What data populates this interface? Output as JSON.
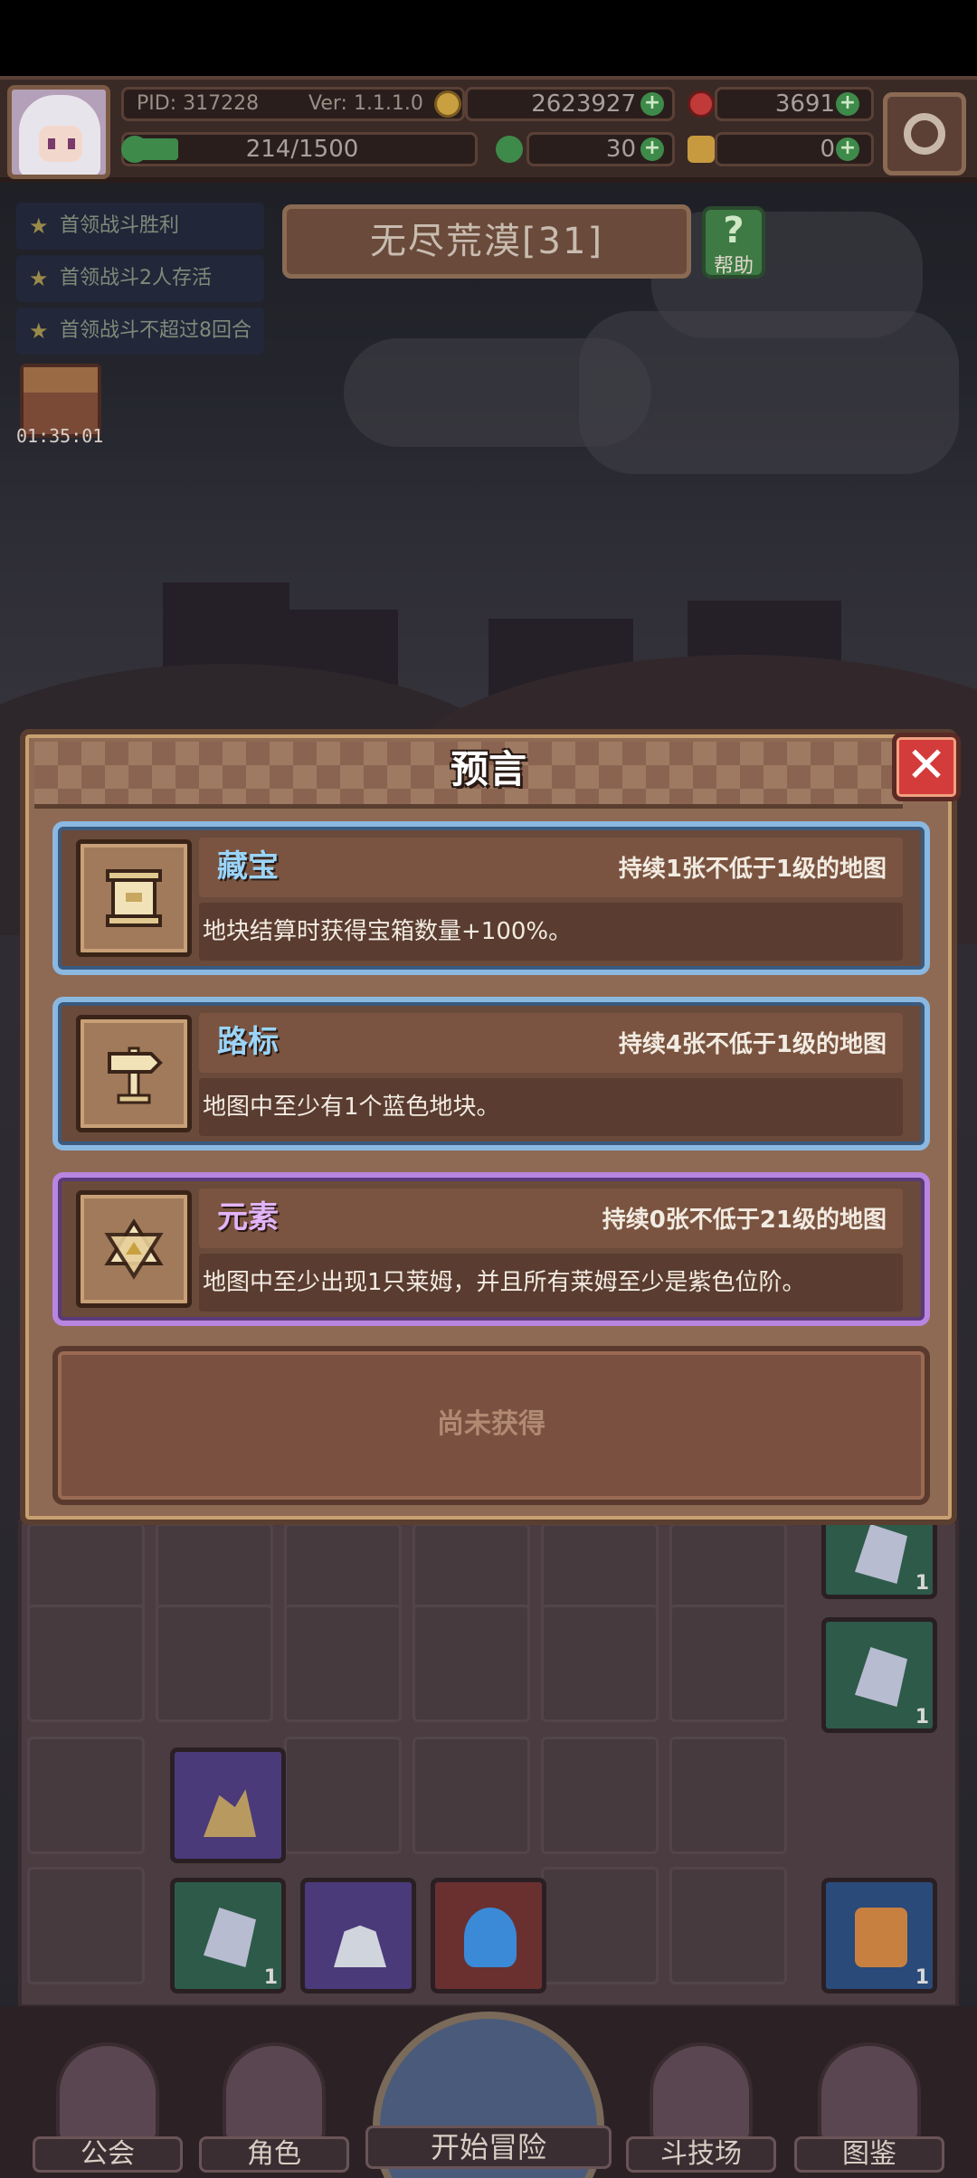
{
  "hud": {
    "pid_label": "PID: 317228",
    "version_label": "Ver: 1.1.1.0",
    "gold": "2623927",
    "gems": "3691",
    "xp": "214/1500",
    "clover": "30",
    "thumb": "0"
  },
  "quests": [
    {
      "label": "首领战斗胜利"
    },
    {
      "label": "首领战斗2人存活"
    },
    {
      "label": "首领战斗不超过8回合"
    }
  ],
  "chest_timer": "01:35:01",
  "map": {
    "title": "无尽荒漠[31]",
    "help_label": "帮助",
    "help_glyph": "?"
  },
  "dialog": {
    "title": "预言",
    "close_glyph": "✕",
    "cards": [
      {
        "name": "藏宝",
        "duration": "持续1张不低于1级的地图",
        "description": "地块结算时获得宝箱数量+100%。",
        "rarity": "blue",
        "icon": "treasure-scroll-icon"
      },
      {
        "name": "路标",
        "duration": "持续4张不低于1级的地图",
        "description": "地图中至少有1个蓝色地块。",
        "rarity": "blue",
        "icon": "signpost-icon"
      },
      {
        "name": "元素",
        "duration": "持续0张不低于21级的地图",
        "description": "地图中至少出现1只莱姆，并且所有莱姆至少是紫色位阶。",
        "rarity": "purple",
        "icon": "hexagram-icon"
      }
    ],
    "empty_slot_label": "尚未获得"
  },
  "board_tiles": {
    "levels": [
      "1",
      "1",
      "1",
      "1"
    ]
  },
  "nav": {
    "guild": "公会",
    "character": "角色",
    "adventure": "开始冒险",
    "arena": "斗技场",
    "codex": "图鉴"
  },
  "colors": {
    "blue_border": "#8ab8e0",
    "purple_border": "#b886e0",
    "close_red": "#d43c3c"
  }
}
